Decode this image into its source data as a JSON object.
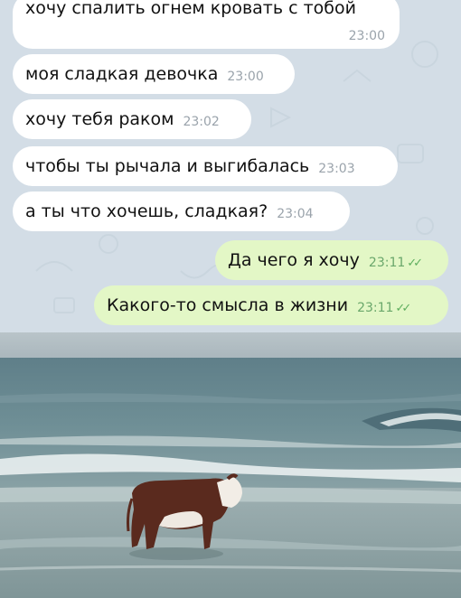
{
  "messages": [
    {
      "text": "хочу спалить огнем кровать с тобой",
      "time": "23:00",
      "direction": "incoming"
    },
    {
      "text": "моя сладкая девочка",
      "time": "23:00",
      "direction": "incoming"
    },
    {
      "text": "хочу тебя раком",
      "time": "23:02",
      "direction": "incoming"
    },
    {
      "text": "чтобы ты рычала и выгибалась",
      "time": "23:03",
      "direction": "incoming"
    },
    {
      "text": "а ты что хочешь, сладкая?",
      "time": "23:04",
      "direction": "incoming"
    },
    {
      "text": "Да чего я хочу",
      "time": "23:11",
      "direction": "outgoing",
      "read": true
    },
    {
      "text": "Какого-то смысла в жизни",
      "time": "23:11",
      "direction": "outgoing",
      "read": true
    }
  ],
  "colors": {
    "chat_background": "#d3dde6",
    "incoming_bubble": "#ffffff",
    "outgoing_bubble": "#e3f7c6",
    "read_checks": "#5eae5e"
  },
  "photo": {
    "subject": "cow standing in sea surf"
  }
}
